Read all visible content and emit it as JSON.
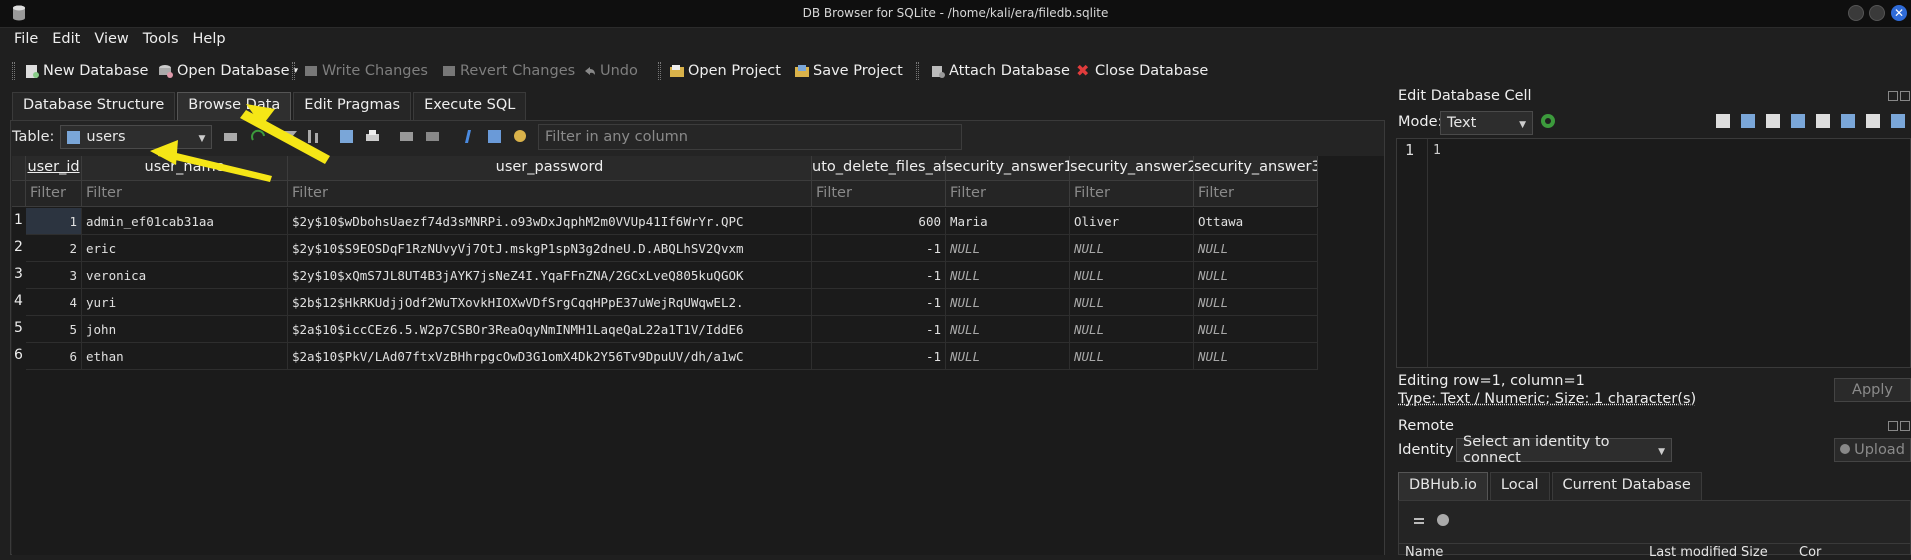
{
  "window": {
    "title": "DB Browser for SQLite - /home/kali/era/filedb.sqlite"
  },
  "menu": [
    "File",
    "Edit",
    "View",
    "Tools",
    "Help"
  ],
  "toolbar": {
    "new_db": "New Database",
    "open_db": "Open Database",
    "write": "Write Changes",
    "revert": "Revert Changes",
    "undo": "Undo",
    "open_project": "Open Project",
    "save_project": "Save Project",
    "attach": "Attach Database",
    "close_db": "Close Database"
  },
  "tabs": [
    "Database Structure",
    "Browse Data",
    "Edit Pragmas",
    "Execute SQL"
  ],
  "table_select": {
    "label": "Table:",
    "value": "users"
  },
  "filter_all": {
    "placeholder": "Filter in any column"
  },
  "columns": [
    "user_id",
    "user_name",
    "user_password",
    "uto_delete_files_aft",
    "security_answer1",
    "security_answer2",
    "security_answer3"
  ],
  "filter_placeholder": "Filter",
  "rows": [
    {
      "n": "1",
      "id": "1",
      "name": "admin_ef01cab31aa",
      "pw": "$2y$10$wDbohsUaezf74d3sMNRPi.o93wDxJqphM2m0VVUp41If6WrYr.QPC",
      "auto": "600",
      "a1": "Maria",
      "a2": "Oliver",
      "a3": "Ottawa"
    },
    {
      "n": "2",
      "id": "2",
      "name": "eric",
      "pw": "$2y$10$S9EOSDqF1RzNUvyVj7OtJ.mskgP1spN3g2dneU.D.ABQLhSV2Qvxm",
      "auto": "-1",
      "a1": "NULL",
      "a2": "NULL",
      "a3": "NULL"
    },
    {
      "n": "3",
      "id": "3",
      "name": "veronica",
      "pw": "$2y$10$xQmS7JL8UT4B3jAYK7jsNeZ4I.YqaFFnZNA/2GCxLveQ805kuQGOK",
      "auto": "-1",
      "a1": "NULL",
      "a2": "NULL",
      "a3": "NULL"
    },
    {
      "n": "4",
      "id": "4",
      "name": "yuri",
      "pw": "$2b$12$HkRKUdjjOdf2WuTXovkHIOXwVDfSrgCqqHPpE37uWejRqUWqwEL2.",
      "auto": "-1",
      "a1": "NULL",
      "a2": "NULL",
      "a3": "NULL"
    },
    {
      "n": "5",
      "id": "5",
      "name": "john",
      "pw": "$2a$10$iccCEz6.5.W2p7CSBOr3ReaOqyNmINMH1LaqeQaL22a1T1V/IddE6",
      "auto": "-1",
      "a1": "NULL",
      "a2": "NULL",
      "a3": "NULL"
    },
    {
      "n": "6",
      "id": "6",
      "name": "ethan",
      "pw": "$2a$10$PkV/LAd07ftxVzBHhrpgcOwD3G1omX4Dk2Y56Tv9DpuUV/dh/a1wC",
      "auto": "-1",
      "a1": "NULL",
      "a2": "NULL",
      "a3": "NULL"
    }
  ],
  "edit_cell": {
    "title": "Edit Database Cell",
    "mode_label": "Mode:",
    "mode_value": "Text",
    "line_no": "1",
    "value": "1",
    "status1": "Editing row=1, column=1",
    "status2": "Type: Text / Numeric; Size: 1 character(s)",
    "apply": "Apply"
  },
  "remote": {
    "title": "Remote",
    "identity_label": "Identity",
    "identity_value": "Select an identity to connect",
    "upload": "Upload",
    "tabs": [
      "DBHub.io",
      "Local",
      "Current Database"
    ],
    "cols": [
      "Name",
      "Last modified",
      "Size",
      "Cor"
    ]
  },
  "colors": {
    "annotation_arrow": "#f5e616",
    "selection": "#2c3440",
    "close_button": "#2f6bd8"
  }
}
